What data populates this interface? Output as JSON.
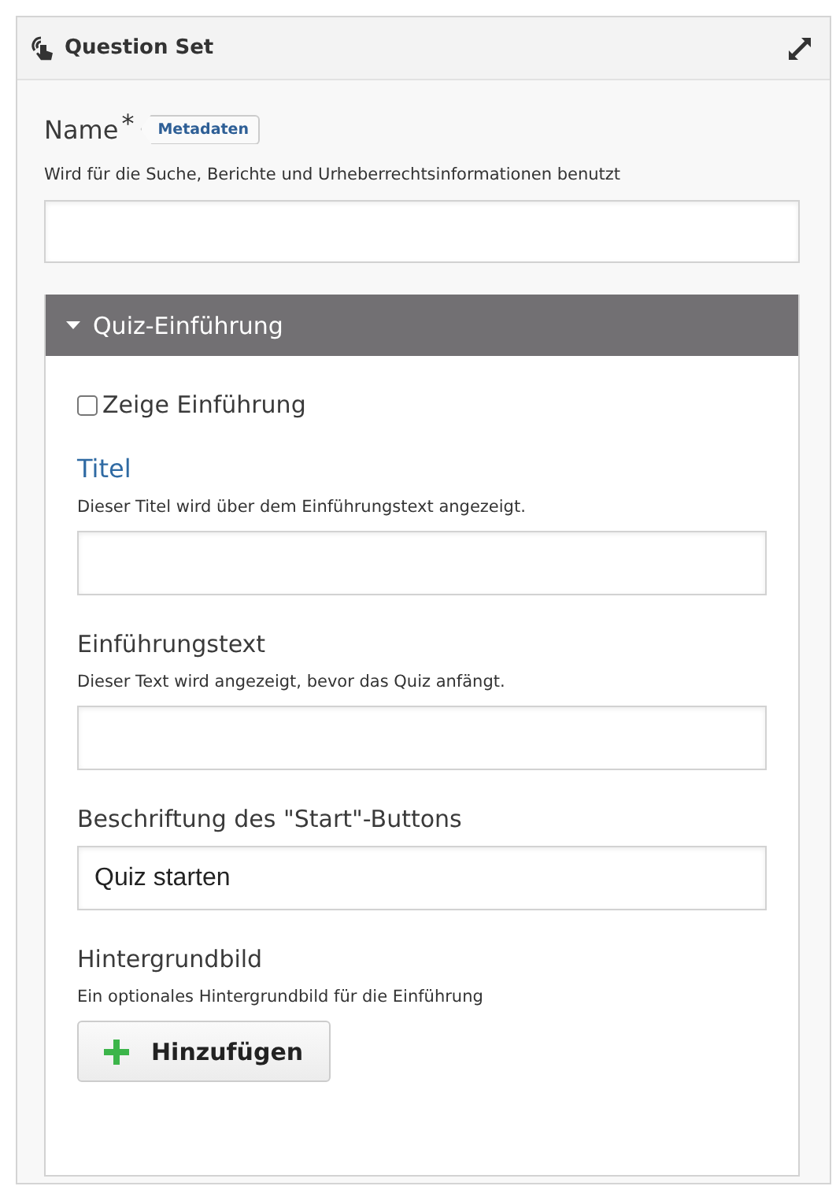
{
  "panel": {
    "title": "Question Set",
    "expanded": false
  },
  "name_field": {
    "label": "Name",
    "required_mark": "*",
    "tag": "Metadaten",
    "description": "Wird für die Suche, Berichte und Urheberrechtsinformationen benutzt"
  },
  "section": {
    "title": "Quiz-Einführung",
    "expanded": true,
    "fields": [
      {
        "kind": "checkbox",
        "label": "Zeige Einführung",
        "checked": false
      },
      {
        "kind": "text",
        "label": "Titel",
        "highlighted": true,
        "description": "Dieser Titel wird über dem Einführungstext angezeigt."
      },
      {
        "kind": "text",
        "label": "Einführungstext",
        "highlighted": false,
        "description": "Dieser Text wird angezeigt, bevor das Quiz anfängt."
      },
      {
        "kind": "text",
        "label": "Beschriftung des \"Start\"-Buttons",
        "highlighted": false,
        "value": "Quiz starten"
      },
      {
        "kind": "image",
        "label": "Hintergrundbild",
        "description": "Ein optionales Hintergrundbild für die Einführung",
        "button": "Hinzufügen"
      }
    ]
  }
}
